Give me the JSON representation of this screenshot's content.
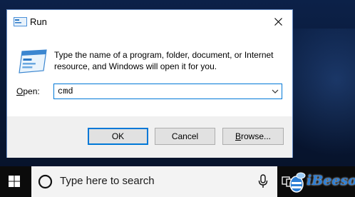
{
  "dialog": {
    "title": "Run",
    "description": "Type the name of a program, folder, document, or Internet resource, and Windows will open it for you.",
    "open_label_accel": "O",
    "open_label_rest": "pen:",
    "open_value": "cmd",
    "buttons": {
      "ok": "OK",
      "cancel": "Cancel",
      "browse_accel": "B",
      "browse_rest": "rowse..."
    }
  },
  "taskbar": {
    "search_placeholder": "Type here to search"
  },
  "watermark": {
    "text": "iBeesoft"
  },
  "colors": {
    "accent": "#0078d7",
    "taskbar": "#0b0b0b",
    "button_face": "#e1e1e1",
    "dialog_footer": "#f0f0f0"
  }
}
